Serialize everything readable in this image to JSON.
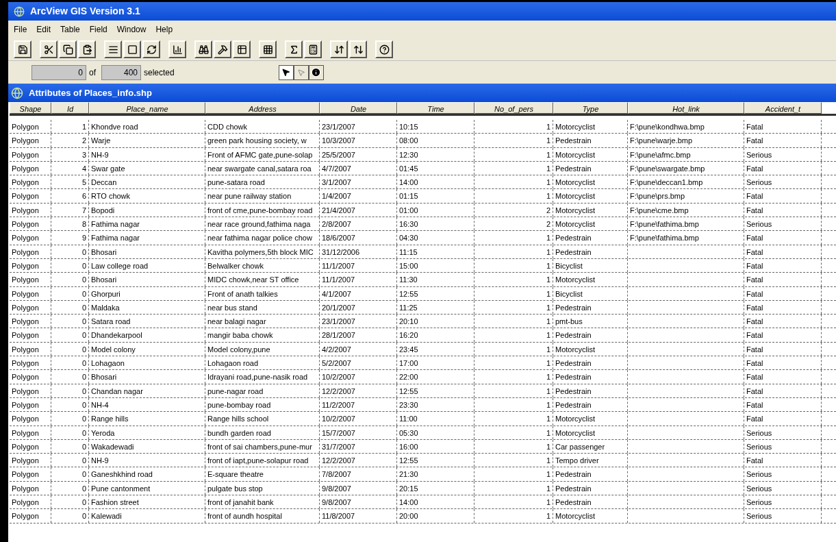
{
  "window": {
    "title": "ArcView GIS Version 3.1"
  },
  "menu": [
    "File",
    "Edit",
    "Table",
    "Field",
    "Window",
    "Help"
  ],
  "selection": {
    "count": "0",
    "of": "of",
    "total": "400",
    "suffix": "selected"
  },
  "table_window": {
    "title": "Attributes of Places_info.shp"
  },
  "columns": [
    "Shape",
    "Id",
    "Place_name",
    "Address",
    "Date",
    "Time",
    "No_of_pers",
    "Type",
    "Hot_link",
    "Accident_t"
  ],
  "rows": [
    [
      "Polygon",
      "1",
      "Khondve road",
      "CDD chowk",
      "23/1/2007",
      "10:15",
      "1",
      "Motorcyclist",
      "F:\\pune\\kondhwa.bmp",
      "Fatal"
    ],
    [
      "Polygon",
      "2",
      "Warje",
      "green park housing society, w",
      "10/3/2007",
      "08:00",
      "1",
      "Pedestrain",
      "F:\\pune\\warje.bmp",
      "Fatal"
    ],
    [
      "Polygon",
      "3",
      "NH-9",
      "Front of AFMC gate,pune-solap",
      "25/5/2007",
      "12:30",
      "1",
      "Motorcyclist",
      "F:\\pune\\afmc.bmp",
      "Serious"
    ],
    [
      "Polygon",
      "4",
      "Swar gate",
      "near swargate canal,satara roa",
      "4/7/2007",
      "01:45",
      "1",
      "Pedestrain",
      "F:\\pune\\swargate.bmp",
      "Fatal"
    ],
    [
      "Polygon",
      "5",
      "Deccan",
      "pune-satara road",
      "3/1/2007",
      "14:00",
      "1",
      "Motorcyclist",
      "F:\\pune\\deccan1.bmp",
      "Serious"
    ],
    [
      "Polygon",
      "6",
      "RTO chowk",
      "near pune railway station",
      "1/4/2007",
      "01:15",
      "1",
      "Motorcyclist",
      "F:\\pune\\prs.bmp",
      "Fatal"
    ],
    [
      "Polygon",
      "7",
      "Bopodi",
      "front of cme,pune-bombay road",
      "21/4/2007",
      "01:00",
      "2",
      "Motorcyclist",
      "F:\\pune\\cme.bmp",
      "Fatal"
    ],
    [
      "Polygon",
      "8",
      "Fathima nagar",
      "near race ground,fathima naga",
      "2/8/2007",
      "16:30",
      "2",
      "Motorcyclist",
      "F:\\pune\\fathima.bmp",
      "Serious"
    ],
    [
      "Polygon",
      "9",
      "Fathima nagar",
      "near fathima nagar police chow",
      "18/6/2007",
      "04:30",
      "1",
      "Pedestrain",
      "F:\\pune\\fathima.bmp",
      "Fatal"
    ],
    [
      "Polygon",
      "0",
      "Bhosari",
      "Kavitha polymers,5th block MIC",
      "31/12/2006",
      "11:15",
      "1",
      "Pedestrain",
      "",
      "Fatal"
    ],
    [
      "Polygon",
      "0",
      "Law college road",
      "Belwalker chowk",
      "11/1/2007",
      "15:00",
      "1",
      "Bicyclist",
      "",
      "Fatal"
    ],
    [
      "Polygon",
      "0",
      "Bhosari",
      "MIDC chowk,near ST office",
      "11/1/2007",
      "11:30",
      "1",
      "Motorcyclist",
      "",
      "Fatal"
    ],
    [
      "Polygon",
      "0",
      "Ghorpuri",
      "Front of anath talkies",
      "4/1/2007",
      "12:55",
      "1",
      "Bicyclist",
      "",
      "Fatal"
    ],
    [
      "Polygon",
      "0",
      "Maldaka",
      "near bus stand",
      "20/1/2007",
      "11:25",
      "1",
      "Pedestrain",
      "",
      "Fatal"
    ],
    [
      "Polygon",
      "0",
      "Satara road",
      "near balagi nagar",
      "23/1/2007",
      "20:10",
      "1",
      "pmt-bus",
      "",
      "Fatal"
    ],
    [
      "Polygon",
      "0",
      "Dhandekarpool",
      "mangir baba chowk",
      "28/1/2007",
      "16:20",
      "1",
      "Pedestrain",
      "",
      "Fatal"
    ],
    [
      "Polygon",
      "0",
      "Model colony",
      "Model colony,pune",
      "4/2/2007",
      "23:45",
      "1",
      "Motorcyclist",
      "",
      "Fatal"
    ],
    [
      "Polygon",
      "0",
      "Lohagaon",
      "Lohagaon road",
      "5/2/2007",
      "17:00",
      "1",
      "Pedestrain",
      "",
      "Fatal"
    ],
    [
      "Polygon",
      "0",
      "Bhosari",
      "Idrayani road,pune-nasik road",
      "10/2/2007",
      "22:00",
      "1",
      "Pedestrain",
      "",
      "Fatal"
    ],
    [
      "Polygon",
      "0",
      "Chandan nagar",
      "pune-nagar road",
      "12/2/2007",
      "12:55",
      "1",
      "Pedestrain",
      "",
      "Fatal"
    ],
    [
      "Polygon",
      "0",
      "NH-4",
      "pune-bombay road",
      "11/2/2007",
      "23:30",
      "1",
      "Pedestrain",
      "",
      "Fatal"
    ],
    [
      "Polygon",
      "0",
      "Range hills",
      "Range hills school",
      "10/2/2007",
      "11:00",
      "1",
      "Motorcyclist",
      "",
      "Fatal"
    ],
    [
      "Polygon",
      "0",
      "Yeroda",
      "bundh garden road",
      "15/7/2007",
      "05:30",
      "1",
      "Motorcyclist",
      "",
      "Serious"
    ],
    [
      "Polygon",
      "0",
      "Wakadewadi",
      "front of sai chambers,pune-mur",
      "31/7/2007",
      "16:00",
      "1",
      "Car passenger",
      "",
      "Serious"
    ],
    [
      "Polygon",
      "0",
      "NH-9",
      "front of iapt,pune-solapur road",
      "12/2/2007",
      "12:55",
      "1",
      "Tempo driver",
      "",
      "Fatal"
    ],
    [
      "Polygon",
      "0",
      "Ganeshkhind road",
      "E-square theatre",
      "7/8/2007",
      "21:30",
      "1",
      "Pedestrain",
      "",
      "Serious"
    ],
    [
      "Polygon",
      "0",
      "Pune cantonment",
      "pulgate bus stop",
      "9/8/2007",
      "20:15",
      "1",
      "Pedestrain",
      "",
      "Serious"
    ],
    [
      "Polygon",
      "0",
      "Fashion street",
      "front of janahit bank",
      "9/8/2007",
      "14:00",
      "1",
      "Pedestrain",
      "",
      "Serious"
    ],
    [
      "Polygon",
      "0",
      "Kalewadi",
      "front of aundh hospital",
      "11/8/2007",
      "20:00",
      "1",
      "Motorcyclist",
      "",
      "Serious"
    ]
  ]
}
